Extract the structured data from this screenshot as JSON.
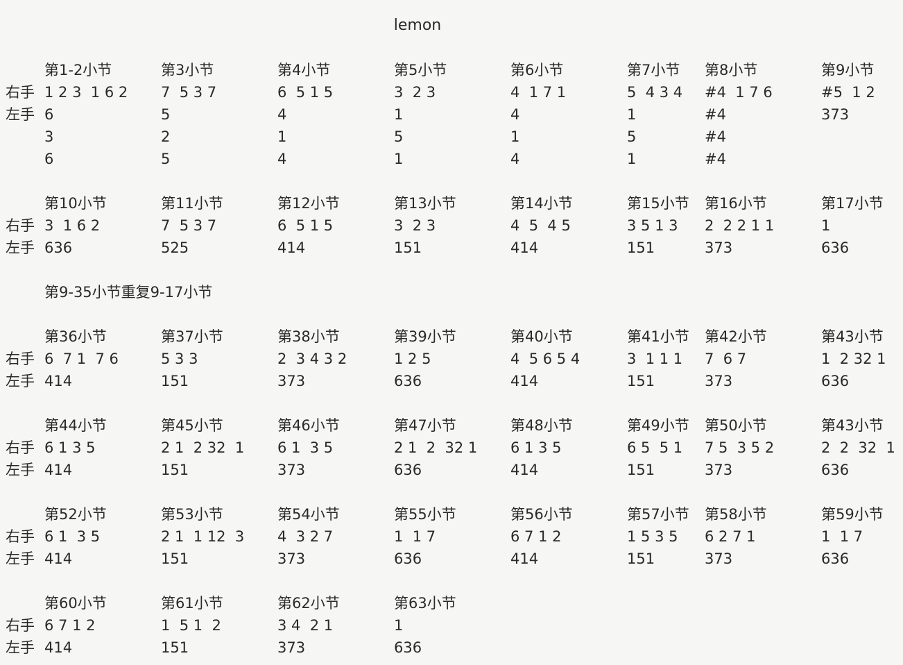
{
  "title": "lemon",
  "labels": {
    "right": "右手",
    "left": "左手"
  },
  "note": "第9-35小节重复9-17小节",
  "blocks": [
    {
      "measures": [
        "第1-2小节",
        "第3小节",
        "第4小节",
        "第5小节",
        "第6小节",
        "第7小节",
        "第8小节",
        "第9小节"
      ],
      "right": [
        "1 2 3  1 6 2",
        "7  5 3 7",
        "6  5 1 5",
        "3  2 3",
        "4  1 7 1",
        "5  4 3 4",
        "#4  1 7 6",
        "#5  1 2"
      ],
      "left": [
        [
          "6",
          "5",
          "4",
          "1",
          "4",
          "1",
          "#4",
          "373"
        ],
        [
          "3",
          "2",
          "1",
          "5",
          "1",
          "5",
          "#4",
          ""
        ],
        [
          "6",
          "5",
          "4",
          "1",
          "4",
          "1",
          "#4",
          ""
        ]
      ]
    },
    {
      "measures": [
        "第10小节",
        "第11小节",
        "第12小节",
        "第13小节",
        "第14小节",
        "第15小节",
        "第16小节",
        "第17小节"
      ],
      "right": [
        "3  1 6 2",
        "7  5 3 7",
        "6  5 1 5",
        "3  2 3",
        "4  5  4 5",
        "3 5 1 3",
        "2  2 2 1 1",
        "1"
      ],
      "left": [
        [
          "636",
          "525",
          "414",
          "151",
          "414",
          "151",
          "373",
          "636"
        ]
      ]
    },
    {
      "measures": [
        "第36小节",
        "第37小节",
        "第38小节",
        "第39小节",
        "第40小节",
        "第41小节",
        "第42小节",
        "第43小节"
      ],
      "right": [
        "6  7 1  7 6",
        "5 3 3",
        "2  3 4 3 2",
        "1 2 5",
        "4  5 6 5 4",
        "3  1 1 1",
        "7  6 7",
        "1  2 32 1"
      ],
      "left": [
        [
          "414",
          "151",
          "373",
          "636",
          "414",
          "151",
          "373",
          "636"
        ]
      ]
    },
    {
      "measures": [
        "第44小节",
        "第45小节",
        "第46小节",
        "第47小节",
        "第48小节",
        "第49小节",
        "第50小节",
        "第43小节"
      ],
      "right": [
        "6 1 3 5",
        "2 1  2 32  1",
        "6 1  3 5",
        "2 1  2  32 1",
        "6 1 3 5",
        "6 5  5 1",
        "7 5  3 5 2",
        "2  2  32  1"
      ],
      "left": [
        [
          "414",
          "151",
          "373",
          "636",
          "414",
          "151",
          "373",
          "636"
        ]
      ]
    },
    {
      "measures": [
        "第52小节",
        "第53小节",
        "第54小节",
        "第55小节",
        "第56小节",
        "第57小节",
        "第58小节",
        "第59小节"
      ],
      "right": [
        "6 1  3 5",
        "2 1  1 12  3",
        "4  3 2 7",
        "1  1 7",
        "6 7 1 2",
        "1 5 3 5",
        "6 2 7 1",
        "1  1 7"
      ],
      "left": [
        [
          "414",
          "151",
          "373",
          "636",
          "414",
          "151",
          "373",
          "636"
        ]
      ]
    },
    {
      "measures": [
        "第60小节",
        "第61小节",
        "第62小节",
        "第63小节"
      ],
      "right": [
        "6 7 1 2",
        "1  5 1  2",
        "3 4  2 1",
        "1"
      ],
      "left": [
        [
          "414",
          "151",
          "373",
          "636"
        ]
      ]
    }
  ]
}
